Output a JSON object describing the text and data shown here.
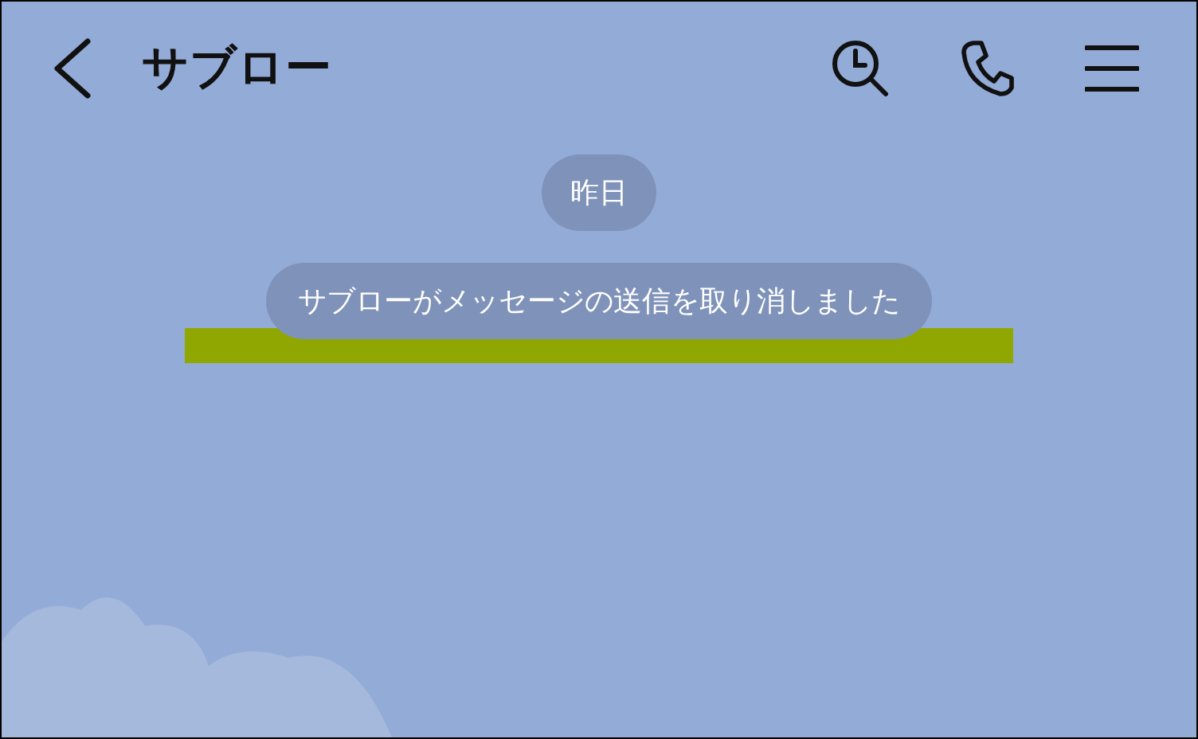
{
  "header": {
    "title": "サブロー"
  },
  "date_separator": "昨日",
  "system_message": "サブローがメッセージの送信を取り消しました"
}
